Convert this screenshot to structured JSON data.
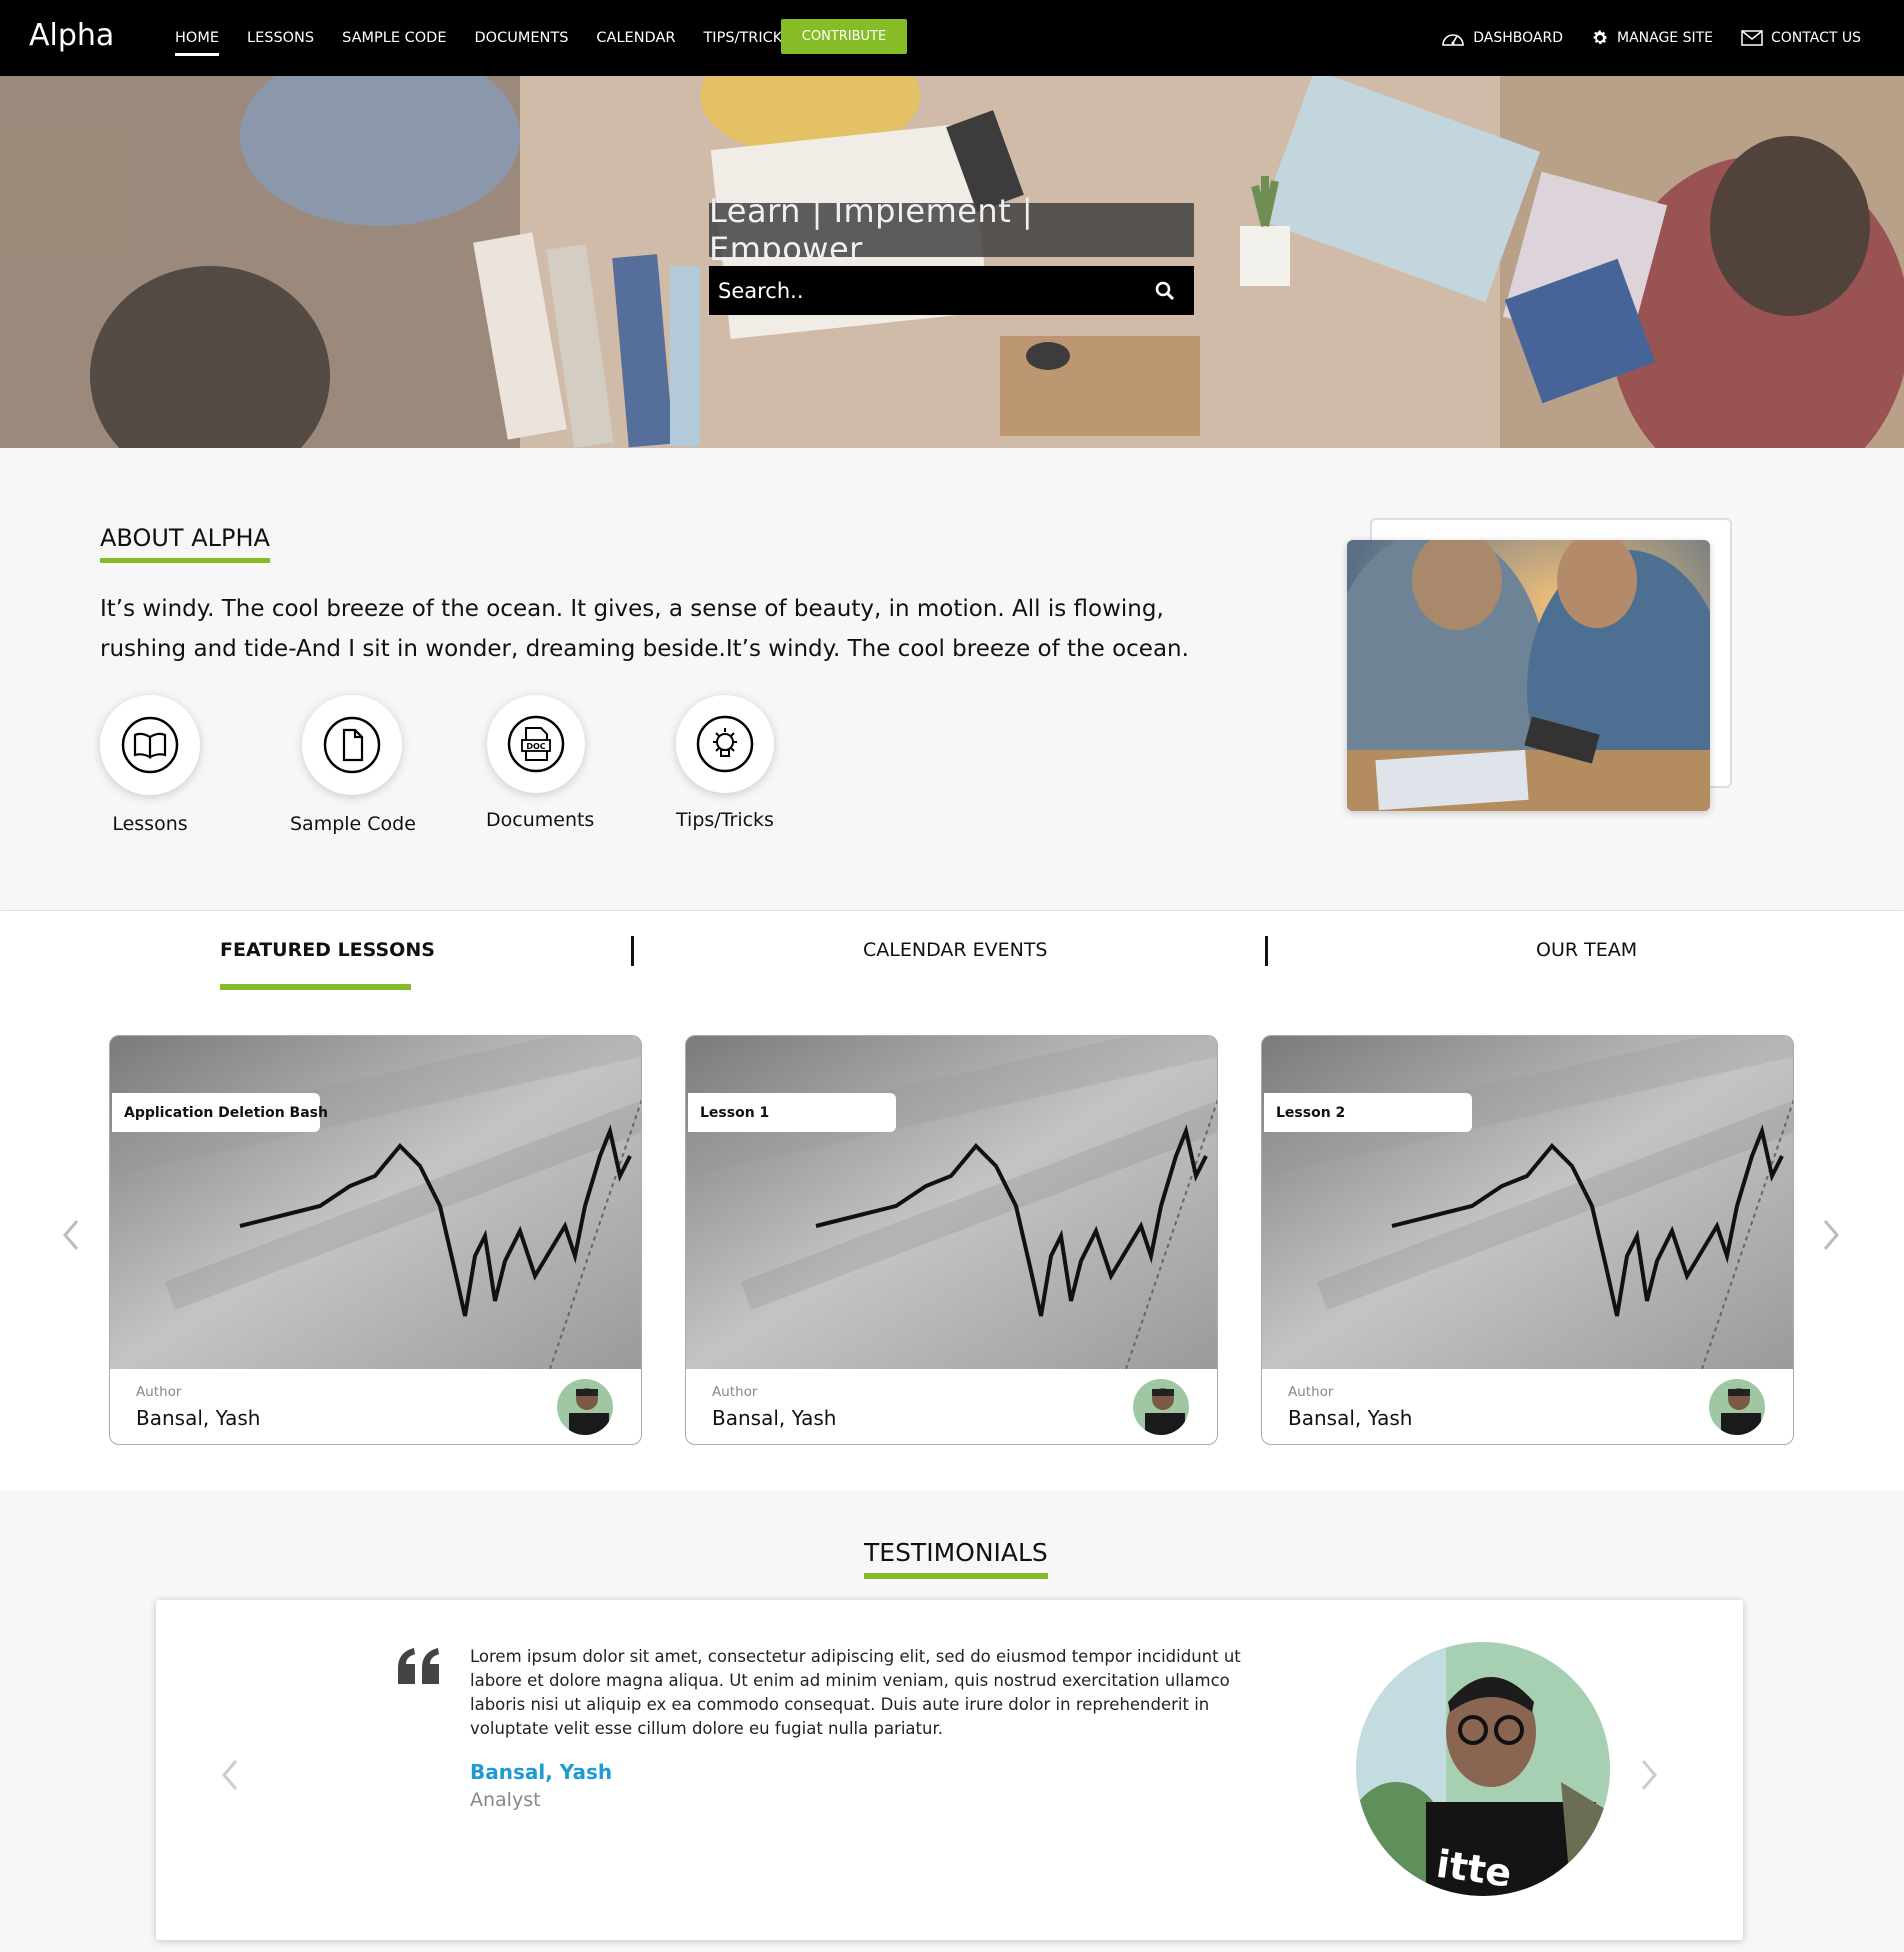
{
  "nav": {
    "brand": "Alpha",
    "links": [
      "HOME",
      "LESSONS",
      "SAMPLE CODE",
      "DOCUMENTS",
      "CALENDAR",
      "TIPS/TRICKS"
    ],
    "active": "HOME",
    "contribute": "CONTRIBUTE",
    "right": [
      {
        "label": "DASHBOARD",
        "icon": "dashboard-icon"
      },
      {
        "label": "MANAGE SITE",
        "icon": "gear-icon"
      },
      {
        "label": "CONTACT US",
        "icon": "envelope-icon"
      }
    ]
  },
  "hero": {
    "tagline": "Learn | Implement | Empower",
    "search_placeholder": "Search..",
    "search_icon": "search-icon"
  },
  "about": {
    "title": "ABOUT ALPHA",
    "text": "It’s windy. The cool breeze of the ocean. It gives, a sense of beauty, in motion. All is flowing, rushing and tide-And I sit in wonder, dreaming beside.It’s windy. The cool breeze of the ocean.",
    "quick_links": [
      {
        "label": "Lessons",
        "icon": "book-icon"
      },
      {
        "label": "Sample Code",
        "icon": "file-icon"
      },
      {
        "label": "Documents",
        "icon": "doc-icon"
      },
      {
        "label": "Tips/Tricks",
        "icon": "lightbulb-icon"
      }
    ]
  },
  "tabs": {
    "items": [
      "FEATURED LESSONS",
      "CALENDAR EVENTS",
      "OUR TEAM"
    ],
    "active": "FEATURED LESSONS"
  },
  "cards": [
    {
      "title": "Application Deletion Bash",
      "author_label": "Author",
      "author": "Bansal, Yash"
    },
    {
      "title": "Lesson 1",
      "author_label": "Author",
      "author": "Bansal, Yash"
    },
    {
      "title": "Lesson 2",
      "author_label": "Author",
      "author": "Bansal, Yash"
    }
  ],
  "testimonials": {
    "title": "TESTIMONIALS",
    "quote": "Lorem ipsum dolor sit amet, consectetur adipiscing elit, sed do eiusmod tempor incididunt ut labore et dolore magna aliqua. Ut enim ad minim veniam, quis nostrud exercitation ullamco laboris nisi ut aliquip ex ea commodo consequat. Duis aute irure dolor in reprehenderit in voluptate velit esse cillum dolore eu fugiat nulla pariatur.",
    "name": "Bansal, Yash",
    "role": "Analyst"
  },
  "colors": {
    "accent": "#86bc25",
    "nav_bg": "#000000",
    "link_blue": "#1e9ad6"
  }
}
